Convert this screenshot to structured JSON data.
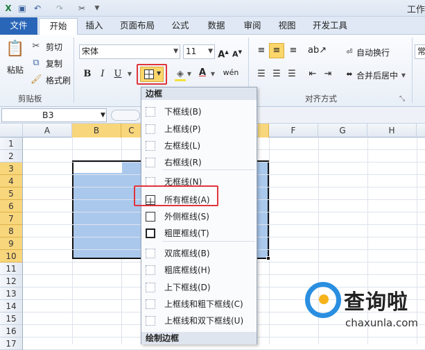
{
  "title": "工作",
  "tabs": [
    "文件",
    "开始",
    "插入",
    "页面布局",
    "公式",
    "数据",
    "审阅",
    "视图",
    "开发工具"
  ],
  "clipboard": {
    "paste": "粘贴",
    "cut": "剪切",
    "copy": "复制",
    "format_painter": "格式刷",
    "group": "剪贴板"
  },
  "font": {
    "name": "宋体",
    "size": "11",
    "bold": "B",
    "italic": "I",
    "underline": "U",
    "text_color_letter": "A"
  },
  "alignment": {
    "wrap": "自动换行",
    "merge": "合并后居中",
    "group": "对齐方式"
  },
  "number_format_partial": "常",
  "name_box": "B3",
  "columns": [
    "A",
    "B",
    "C",
    "D",
    "E",
    "F",
    "G",
    "H"
  ],
  "rows": [
    "1",
    "2",
    "3",
    "4",
    "5",
    "6",
    "7",
    "8",
    "9",
    "10",
    "11",
    "12",
    "13",
    "14",
    "15",
    "16",
    "17"
  ],
  "menu": {
    "header": "边框",
    "items": [
      {
        "label": "下框线(B)"
      },
      {
        "label": "上框线(P)"
      },
      {
        "label": "左框线(L)"
      },
      {
        "label": "右框线(R)"
      },
      {
        "label": "无框线(N)"
      },
      {
        "label": "所有框线(A)"
      },
      {
        "label": "外侧框线(S)"
      },
      {
        "label": "粗匣框线(T)"
      },
      {
        "label": "双底框线(B)"
      },
      {
        "label": "粗底框线(H)"
      },
      {
        "label": "上下框线(D)"
      },
      {
        "label": "上框线和粗下框线(C)"
      },
      {
        "label": "上框线和双下框线(U)"
      }
    ],
    "footer": "绘制边框"
  },
  "watermark": {
    "brand": "查询啦",
    "url": "chaxunla.com"
  },
  "colors": {
    "accent": "#2a66b8",
    "selection": "#aac8ec",
    "highlight": "#e0343c",
    "header_selected": "#f8d67c"
  }
}
